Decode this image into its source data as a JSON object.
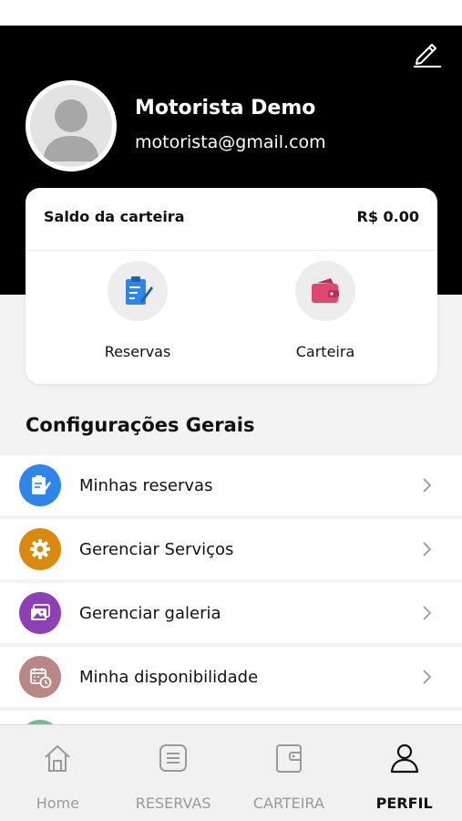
{
  "profile": {
    "name": "Motorista Demo",
    "email": "motorista@gmail.com",
    "edit_icon": "edit-pencil-icon",
    "avatar_icon": "user-silhouette"
  },
  "wallet": {
    "label": "Saldo da carteira",
    "balance": "R$ 0.00",
    "actions": [
      {
        "label": "Reservas",
        "icon": "clipboard-edit-icon",
        "color": "#2f86ea"
      },
      {
        "label": "Carteira",
        "icon": "wallet-icon",
        "color": "#e0466e"
      }
    ]
  },
  "section_title": "Configurações Gerais",
  "menu": [
    {
      "label": "Minhas reservas",
      "icon": "clipboard-edit-icon",
      "color": "#2f86ea"
    },
    {
      "label": "Gerenciar Serviços",
      "icon": "gear-icon",
      "color": "#d9890b"
    },
    {
      "label": "Gerenciar galeria",
      "icon": "gallery-icon",
      "color": "#8d3fb4"
    },
    {
      "label": "Minha disponibilidade",
      "icon": "calendar-clock-icon",
      "color": "#b98785"
    }
  ],
  "menu_peek_color": "#6dbf93",
  "bottom_nav": [
    {
      "label": "Home",
      "icon": "home-icon",
      "active": false
    },
    {
      "label": "RESERVAS",
      "icon": "list-icon",
      "active": false
    },
    {
      "label": "CARTEIRA",
      "icon": "wallet-icon",
      "active": false
    },
    {
      "label": "PERFIL",
      "icon": "person-icon",
      "active": true
    }
  ],
  "colors": {
    "header_bg": "#000000",
    "page_bg": "#f3f3f3",
    "active_nav": "#111111",
    "inactive_nav": "#9a9a9a"
  }
}
